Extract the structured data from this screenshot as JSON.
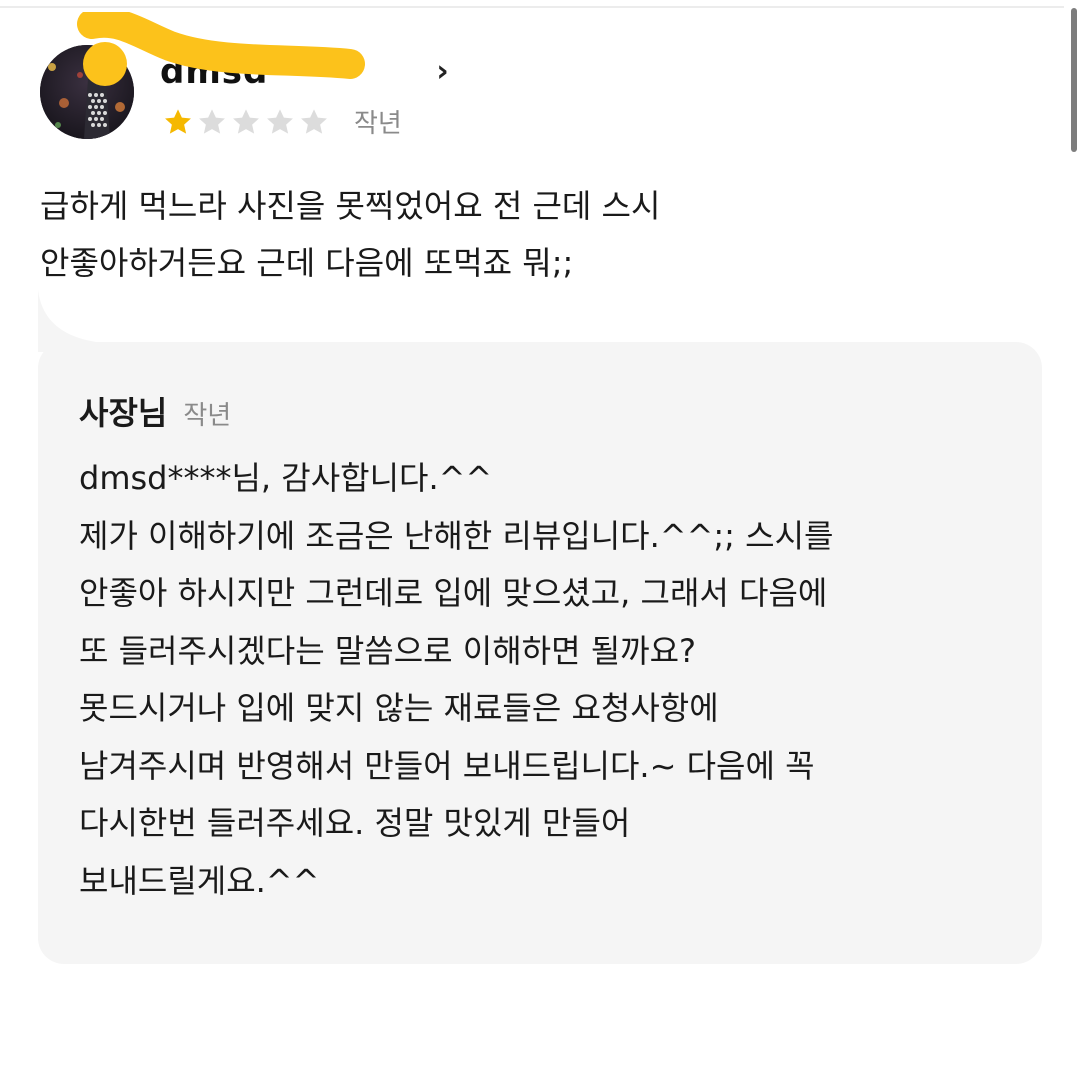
{
  "review": {
    "author_name": "dmsd",
    "rating": 1,
    "max_rating": 5,
    "date": "작년",
    "text": "급하게 먹느라 사진을 못찍었어요 전 근데 스시\n안좋아하거든요 근데 다음에 또먹죠 뭐;;"
  },
  "reply": {
    "author": "사장님",
    "date": "작년",
    "text": "dmsd****님, 감사합니다.^^\n제가 이해하기에 조금은 난해한 리뷰입니다.^^;; 스시를\n안좋아 하시지만 그런데로 입에 맞으셨고, 그래서 다음에\n또 들러주시겠다는 말씀으로 이해하면 될까요?\n못드시거나 입에 맞지 않는 재료들은 요청사항에\n남겨주시며 반영해서 만들어 보내드립니다.~ 다음에 꼭\n다시한번 들러주세요. 정말 맛있게 만들어\n보내드릴게요.^^"
  },
  "colors": {
    "star_filled": "#f5b800",
    "star_empty": "#dcdcdc",
    "redaction": "#fcc21b",
    "reply_background": "#f5f5f5"
  },
  "icons": {
    "chevron": "chevron-right-icon",
    "star": "star-icon"
  }
}
